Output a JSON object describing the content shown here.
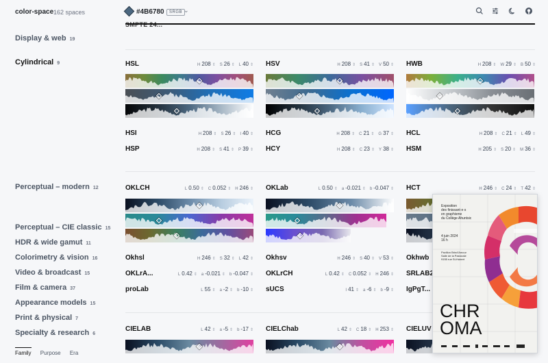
{
  "header": {
    "brand": "color-space",
    "count": "162 spaces",
    "hex": "#4B6780",
    "space_badge": "SRGB",
    "chip_color": "#4b6780"
  },
  "clipped_row": "SMPTE 24...",
  "sidebar": {
    "items": [
      {
        "label": "Display & web",
        "count": "19"
      },
      {
        "label": "Cylindrical",
        "count": "9"
      },
      {
        "label": "Perceptual – modern",
        "count": "12"
      },
      {
        "label": "Perceptual – CIE classic",
        "count": "15"
      },
      {
        "label": "HDR & wide gamut",
        "count": "11"
      },
      {
        "label": "Colorimetry & vision",
        "count": "16"
      },
      {
        "label": "Video & broadcast",
        "count": "15"
      },
      {
        "label": "Film & camera",
        "count": "37"
      },
      {
        "label": "Appearance models",
        "count": "15"
      },
      {
        "label": "Print & physical",
        "count": "7"
      },
      {
        "label": "Specialty & research",
        "count": "6"
      }
    ],
    "tabs": [
      "Family",
      "Purpose",
      "Era"
    ]
  },
  "cards": {
    "hsl": {
      "name": "HSL",
      "vals": [
        [
          "H",
          "208"
        ],
        [
          "S",
          "26"
        ],
        [
          "L",
          "40"
        ]
      ]
    },
    "hsv": {
      "name": "HSV",
      "vals": [
        [
          "H",
          "208"
        ],
        [
          "S",
          "41"
        ],
        [
          "V",
          "50"
        ]
      ]
    },
    "hwb": {
      "name": "HWB",
      "vals": [
        [
          "H",
          "208"
        ],
        [
          "W",
          "29"
        ],
        [
          "B",
          "50"
        ]
      ]
    },
    "hsi": {
      "name": "HSI",
      "vals": [
        [
          "H",
          "208"
        ],
        [
          "S",
          "26"
        ],
        [
          "I",
          "40"
        ]
      ]
    },
    "hcg": {
      "name": "HCG",
      "vals": [
        [
          "H",
          "208"
        ],
        [
          "C",
          "21"
        ],
        [
          "G",
          "37"
        ]
      ]
    },
    "hcl": {
      "name": "HCL",
      "vals": [
        [
          "H",
          "208"
        ],
        [
          "C",
          "21"
        ],
        [
          "L",
          "49"
        ]
      ]
    },
    "hsp": {
      "name": "HSP",
      "vals": [
        [
          "H",
          "208"
        ],
        [
          "S",
          "41"
        ],
        [
          "P",
          "39"
        ]
      ]
    },
    "hcy": {
      "name": "HCY",
      "vals": [
        [
          "H",
          "208"
        ],
        [
          "C",
          "23"
        ],
        [
          "Y",
          "38"
        ]
      ]
    },
    "hsm": {
      "name": "HSM",
      "vals": [
        [
          "H",
          "205"
        ],
        [
          "S",
          "20"
        ],
        [
          "M",
          "36"
        ]
      ]
    },
    "oklch": {
      "name": "OKLCH",
      "vals": [
        [
          "L",
          "0.50"
        ],
        [
          "C",
          "0.052"
        ],
        [
          "H",
          "246"
        ]
      ]
    },
    "oklab": {
      "name": "OKLab",
      "vals": [
        [
          "L",
          "0.50"
        ],
        [
          "a",
          "-0.021"
        ],
        [
          "b",
          "-0.047"
        ]
      ]
    },
    "hct": {
      "name": "HCT",
      "vals": [
        [
          "H",
          "246"
        ],
        [
          "C",
          "24"
        ],
        [
          "T",
          "42"
        ]
      ]
    },
    "okhsl": {
      "name": "Okhsl",
      "vals": [
        [
          "H",
          "246"
        ],
        [
          "S",
          "32"
        ],
        [
          "L",
          "42"
        ]
      ]
    },
    "okhsv": {
      "name": "Okhsv",
      "vals": [
        [
          "H",
          "246"
        ],
        [
          "S",
          "40"
        ],
        [
          "V",
          "53"
        ]
      ]
    },
    "okhwb": {
      "name": "Okhwb",
      "vals": []
    },
    "oklrab": {
      "name": "OKLrA...",
      "vals": [
        [
          "L",
          "0.42"
        ],
        [
          "a",
          "-0.021"
        ],
        [
          "b",
          "-0.047"
        ]
      ]
    },
    "oklrch": {
      "name": "OKLrCH",
      "vals": [
        [
          "L",
          "0.42"
        ],
        [
          "C",
          "0.052"
        ],
        [
          "H",
          "246"
        ]
      ]
    },
    "srlab2": {
      "name": "SRLAB2",
      "vals": []
    },
    "prolab": {
      "name": "proLab",
      "vals": [
        [
          "L",
          "55"
        ],
        [
          "a",
          "-2"
        ],
        [
          "b",
          "-10"
        ]
      ]
    },
    "sucs": {
      "name": "sUCS",
      "vals": [
        [
          "I",
          "41"
        ],
        [
          "a",
          "-6"
        ],
        [
          "b",
          "-9"
        ]
      ]
    },
    "igpgt": {
      "name": "IgPgT...",
      "vals": []
    },
    "cielab": {
      "name": "CIELAB",
      "vals": [
        [
          "L",
          "42"
        ],
        [
          "a",
          "-5"
        ],
        [
          "b",
          "-17"
        ]
      ]
    },
    "cielchab": {
      "name": "CIELChab",
      "vals": [
        [
          "L",
          "42"
        ],
        [
          "C",
          "18"
        ],
        [
          "H",
          "253"
        ]
      ]
    },
    "cieluv": {
      "name": "CIELUV",
      "vals": []
    }
  },
  "poster": {
    "title_lines": [
      "Exposition",
      "des finissant·e·s",
      "en graphisme",
      "du Collège Ahuntsic"
    ],
    "date_lines": [
      "4 juin 2024",
      "16 h"
    ],
    "venue_lines": [
      "Pavillon Brind'Amour",
      "Salle de la Pastorale",
      "9155 rue St-Hubert"
    ],
    "word_lines": [
      "CHR",
      "OMA"
    ]
  }
}
